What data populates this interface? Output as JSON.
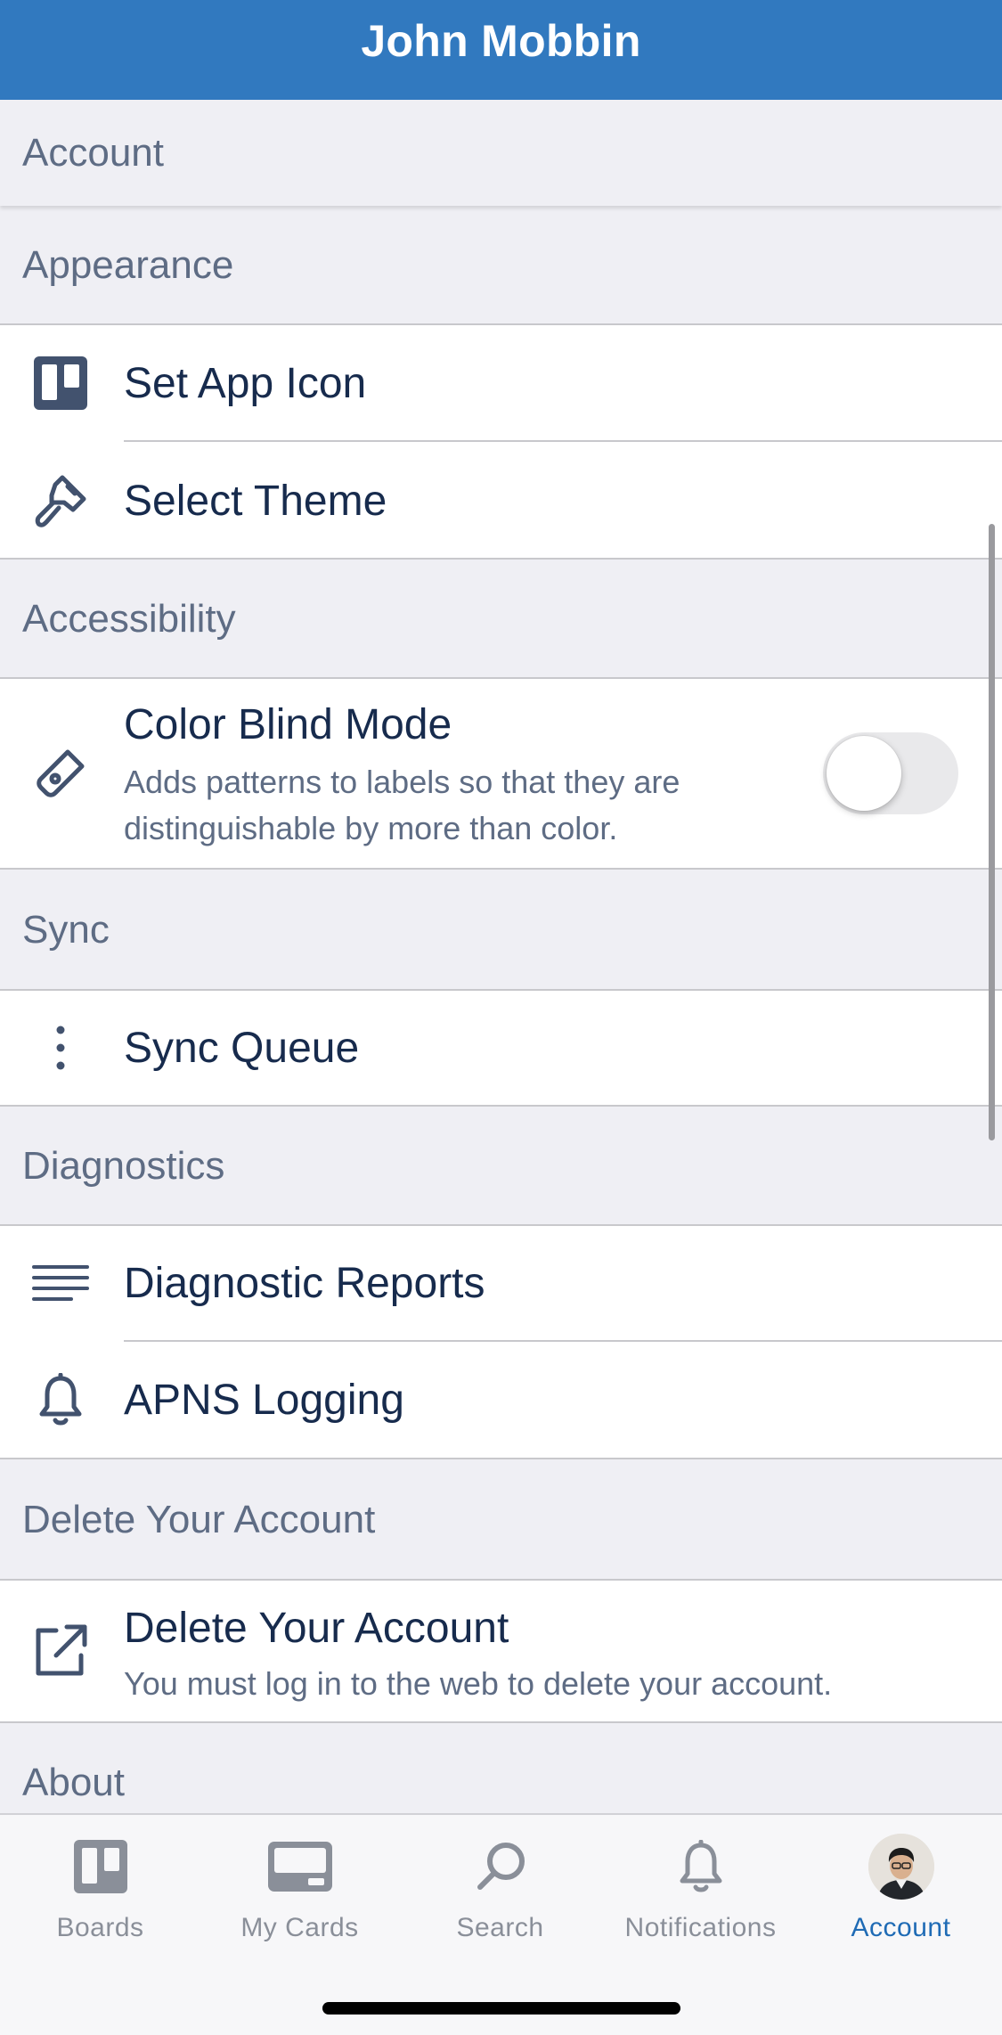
{
  "header": {
    "title": "John Mobbin"
  },
  "sections": {
    "account": "Account",
    "appearance": "Appearance",
    "accessibility": "Accessibility",
    "sync": "Sync",
    "diagnostics": "Diagnostics",
    "delete": "Delete Your Account",
    "about": "About"
  },
  "appearance": {
    "set_app_icon": "Set App Icon",
    "select_theme": "Select Theme"
  },
  "accessibility": {
    "color_blind_label": "Color Blind Mode",
    "color_blind_desc_1": "Adds patterns to labels so that they are",
    "color_blind_desc_2": "distinguishable by more than color.",
    "color_blind_enabled": false
  },
  "sync": {
    "sync_queue": "Sync Queue"
  },
  "diagnostics": {
    "diagnostic_reports": "Diagnostic Reports",
    "apns_logging": "APNS Logging"
  },
  "delete_account": {
    "label": "Delete Your Account",
    "desc": "You must log in to the web to delete your account."
  },
  "tabbar": {
    "boards": "Boards",
    "my_cards": "My Cards",
    "search": "Search",
    "notifications": "Notifications",
    "account": "Account",
    "active": "account"
  },
  "icons": {
    "set_app_icon": "trello-board-icon",
    "select_theme": "paintbrush-icon",
    "color_blind": "tag-icon",
    "sync_queue": "vertical-dots-icon",
    "diagnostic_reports": "lines-icon",
    "apns_logging": "bell-icon",
    "delete_account": "external-link-icon"
  },
  "colors": {
    "brand_blue": "#3179bf",
    "active_tab": "#1f6bb5",
    "inactive_tab": "#8a8f99",
    "text_primary": "#172b4d",
    "text_secondary": "#5e6c84",
    "background": "#efeff4"
  }
}
